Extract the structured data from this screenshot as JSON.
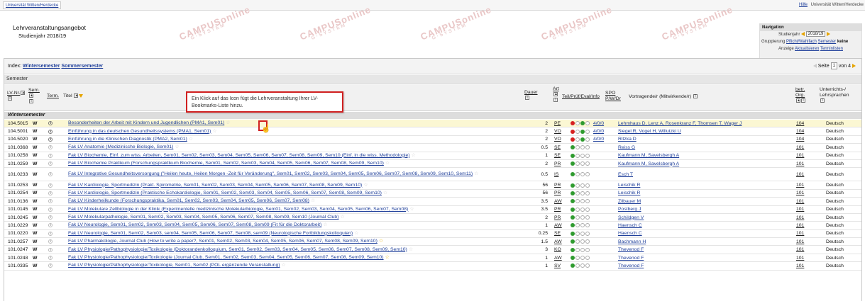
{
  "topbar": {
    "tab": "Universität Witten/Herdecke",
    "help": "Hilfe",
    "org": "Universität Witten/Herdecke"
  },
  "header": {
    "title": "Lehrveranstaltungsangebot",
    "subtitle": "Studienjahr 2018/19",
    "watermark_main": "CAMPUSonline",
    "watermark_sub": "G·SYSTEM"
  },
  "nav": {
    "heading": "Navigation",
    "studienjahr_label": "Studienjahr",
    "studienjahr_value": "2018/19",
    "gruppierung_label": "Gruppierung",
    "gruppierung_opt1": "Pflicht/Wahlfach",
    "gruppierung_opt2": "Semester",
    "gruppierung_opt3": "keine",
    "anzeige_label": "Anzeige",
    "anzeige_opt1": "Aktualisieren",
    "anzeige_opt2": "Terminlisten"
  },
  "index": {
    "label": "Index:",
    "ws": "Wintersemester",
    "ss": "Sommersemester",
    "seite_label": "Seite",
    "seite_value": "1",
    "von_label": "von 4"
  },
  "semester_heading": "Semester",
  "columns": {
    "lvnr": "LV-Nr.",
    "sem": "Sem.",
    "term": "Term.",
    "titel": "Titel",
    "dauer": "Dauer",
    "art": "Art",
    "tpe": "Teil/Prüf/Eval/Info",
    "spo": "SPO",
    "spo2": "P/W/Dr",
    "vortr": "Vortragende/r (Mitwirkende/r)",
    "org1": "betr.",
    "org2": "Org.",
    "lang1": "Unterrichts-/",
    "lang2": "Lehrsprachen"
  },
  "ws_group": "Wintersemester",
  "tooltip": "Ein Klick auf das Icon fügt die Lehrveranstaltung Ihrer LV-Bookmarks-Liste hinzu.",
  "rows": [
    {
      "nr": "104.5015",
      "sem": "W",
      "title": "Besonderheiten der Arbeit mit Kindern und Jugendlichen (PMA1, Sem01)",
      "dauer": "2",
      "art": "PE",
      "spo": "4/0/0",
      "lect": "Lehmhaus D, Lenz A, Rosenkranz F, Thomsen T, Wager J",
      "org": "104",
      "lang": "Deutsch",
      "hl": true,
      "dots": "rgg"
    },
    {
      "nr": "104.5001",
      "sem": "W",
      "title": "Einführung in das deutschen Gesundheitssystems (PMA1, Sem01)",
      "dauer": "2",
      "art": "VO",
      "spo": "4/0/0",
      "lect": "Siegel R, Vogel H, Willutzki U",
      "org": "104",
      "lang": "Deutsch",
      "dots": "rgg"
    },
    {
      "nr": "104.5020",
      "sem": "W",
      "title": "Einführung in die Klinischen Diagnostik (PMA2, Sem01)",
      "dauer": "2",
      "art": "VO",
      "spo": "4/0/0",
      "lect": "Ritzka D",
      "org": "104",
      "lang": "Deutsch",
      "dots": "rgg"
    },
    {
      "nr": "101.0368",
      "sem": "W",
      "title": "Fak LV Anatomie (Medizinische Biologie, Sem01)",
      "dauer": "0.5",
      "art": "SE",
      "spo": "",
      "lect": "Reiss G",
      "org": "101",
      "lang": "Deutsch",
      "dots": "g"
    },
    {
      "nr": "101.0258",
      "sem": "W",
      "title": "Fak LV Biochemie, Einf. zum wiss. Arbeiten, Sem01, Sem02, Sem03, Sem04, Sem05, Sem06, Sem07, Sem08, Sem09, Sem10 (Einf. in die wiss. Methodologie)",
      "dauer": "1",
      "art": "SE",
      "spo": "",
      "lect": "Kaufmann M, Savelsbergh A",
      "org": "101",
      "lang": "Deutsch",
      "dots": "g"
    },
    {
      "nr": "101.0259",
      "sem": "W",
      "title": "Fak LV Biochemie Praktikum (Forschungspraktikum Biochemie, Sem01, Sem02, Sem03, Sem04, Sem05, Sem06, Sem07, Sem08, Sem09, Sem10)",
      "dauer": "2",
      "art": "PR",
      "spo": "",
      "lect": "Kaufmann M, Savelsbergh A",
      "org": "101",
      "lang": "Deutsch",
      "dots": "g"
    },
    {
      "nr": "101.0233",
      "sem": "W",
      "title": "Fak LV Integrative Gesundheitsversorgung (\"Heilen heute, Heilen Morgen -Zeit für Veränderung\", Sem01, Sem02, Sem03, Sem04, Sem05, Sem06, Sem07, Sem08, Sem09, Sem10, Sem11)",
      "dauer": "0.5",
      "art": "IS",
      "spo": "",
      "lect": "Esch T",
      "org": "101",
      "lang": "Deutsch",
      "dots": "g",
      "tall": true
    },
    {
      "nr": "101.0253",
      "sem": "W",
      "title": "Fak LV Kardiologie, Sportmedizin (Prakt. Spirometrie, Sem01, Sem02, Sem03, Sem04, Sem05, Sem06, Sem07, Sem08, Sem09, Sem10)",
      "dauer": "56",
      "art": "PR",
      "spo": "",
      "lect": "Leischik R",
      "org": "101",
      "lang": "Deutsch",
      "dots": "g"
    },
    {
      "nr": "101.0254",
      "sem": "W",
      "title": "Fak LV Kardiologie, Sportmedizin (Praktische Echokardiologie, Sem01, Sem02, Sem03, Sem04, Sem05, Sem06, Sem07, Sem08, Sem09, Sem10)",
      "dauer": "56",
      "art": "PR",
      "spo": "",
      "lect": "Leischik R",
      "org": "101",
      "lang": "Deutsch",
      "dots": "g"
    },
    {
      "nr": "101.0136",
      "sem": "W",
      "title": "Fak LV Kinderheilkunde (Forschungspraktika, Sem01, Sem02, Sem03, Sem04, Sem05, Sem06, Sem07, Sem08)",
      "dauer": "3.5",
      "art": "AW",
      "spo": "",
      "lect": "Zilbauer M",
      "org": "101",
      "lang": "Deutsch",
      "dots": "g"
    },
    {
      "nr": "101.0145",
      "sem": "W",
      "title": "Fak LV Molekulare Zellbiologie in der Klinik (Experimentelle medizinische Molekularbiologie, Sem01, Sem02, Sem03, Sem04, Sem05, Sem06, Sem07, Sem08)",
      "dauer": "3.5",
      "art": "PR",
      "spo": "",
      "lect": "Postberg J",
      "org": "101",
      "lang": "Deutsch",
      "dots": "g"
    },
    {
      "nr": "101.0245",
      "sem": "W",
      "title": "Fak LV Molekularpathologie, Sem01, Sem02, Sem03, Sem04, Sem05, Sem06, Sem07, Sem08, Sem09, Sem10 (Journal Club)",
      "dauer": "2",
      "art": "PR",
      "spo": "",
      "lect": "Schildgen V",
      "org": "101",
      "lang": "Deutsch",
      "dots": "g"
    },
    {
      "nr": "101.0229",
      "sem": "W",
      "title": "Fak LV Neurologie, Sem01, Sem02, Sem03, Sem04, Sem05, Sem06, Sem07, Sem08, Sem09 (Fit für die Doktorarbeit)",
      "dauer": "1",
      "art": "AW",
      "spo": "",
      "lect": "Haensch C",
      "org": "101",
      "lang": "Deutsch",
      "dots": "g"
    },
    {
      "nr": "101.0220",
      "sem": "W",
      "title": "Fak LV Neurologie, Sem01, Sem02, Sem03, sem04, Sem05, Sem06, Sem07, Sem08, sem09 (Neurologische Fortbildungskolloquien)",
      "dauer": "0.25",
      "art": "SE",
      "spo": "",
      "lect": "Haensch C",
      "org": "101",
      "lang": "Deutsch",
      "dots": "g"
    },
    {
      "nr": "101.0257",
      "sem": "W",
      "title": "Fak LV Pharmakologie, Journal Club (How to write a paper?, Sem01, Sem02, Sem03, Sem04, Sem05, Sem06, Sem07, Sem08, Sem09, Sem10)",
      "dauer": "1.5",
      "art": "AW",
      "spo": "",
      "lect": "Bachmann H",
      "org": "101",
      "lang": "Deutsch",
      "dots": "g",
      "gold": true
    },
    {
      "nr": "101.0247",
      "sem": "W",
      "title": "Fak LV Physiologie/Pathophysiologie/Toxikologie (Doktorandenkolloquium, Sem01, Sem02, Sem03, Sem04, Sem05, Sem06, Sem07, Sem08, Sem09, Sem10)",
      "dauer": "3",
      "art": "KO",
      "spo": "",
      "lect": "Thevenod F",
      "org": "101",
      "lang": "Deutsch",
      "dots": "g"
    },
    {
      "nr": "101.0248",
      "sem": "W",
      "title": "Fak LV Physiologie/Pathophysiologie/Toxikologie (Journal Club, Sem01, Sem02, Sem03, Sem04, Sem05, Sem06, Sem07, Sem08, Sem09, Sem10)",
      "dauer": "1",
      "art": "AW",
      "spo": "",
      "lect": "Thevenod F",
      "org": "101",
      "lang": "Deutsch",
      "dots": "g",
      "gold": true
    },
    {
      "nr": "101.0335",
      "sem": "W",
      "title": "Fak LV Physiologie/Pathophysiologie/Toxikologie, Sem01, Sem02 (POL ergänzende Veranstaltung)",
      "dauer": "1",
      "art": "SV",
      "spo": "",
      "lect": "Thevenod F",
      "org": "101",
      "lang": "Deutsch",
      "dots": "g"
    }
  ]
}
